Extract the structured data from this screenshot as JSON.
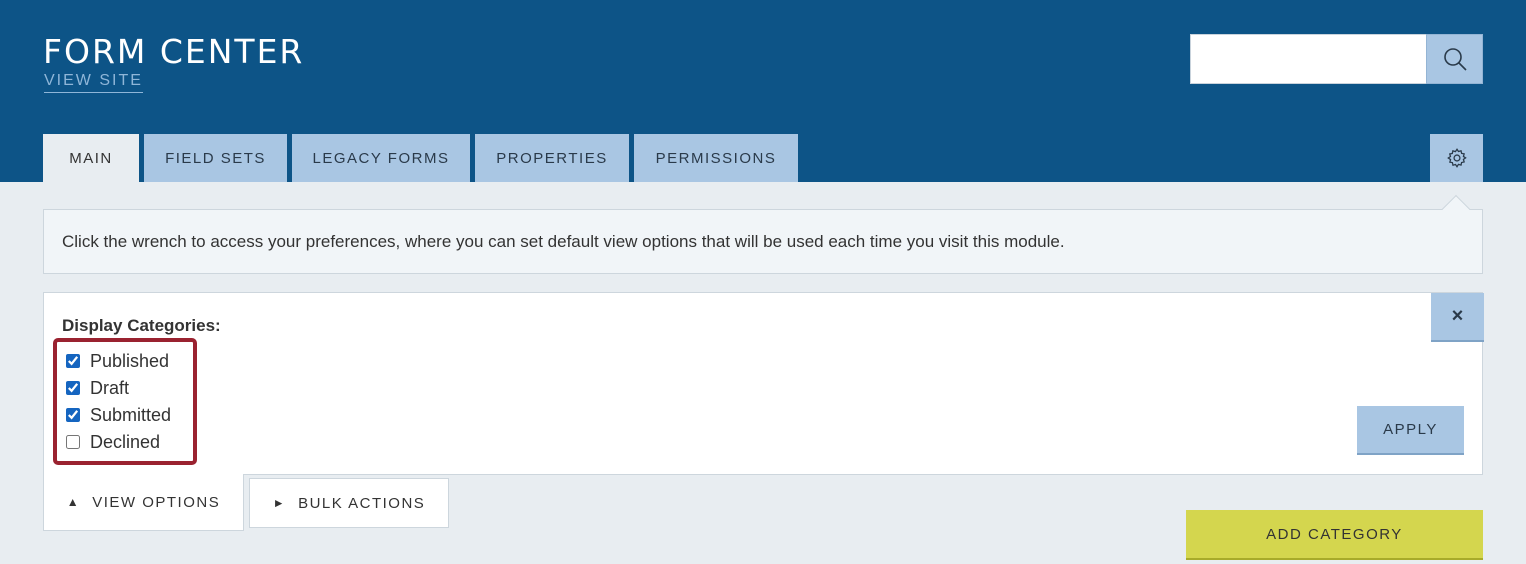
{
  "header": {
    "title": "FORM CENTER",
    "view_site": "VIEW SITE",
    "search": {
      "value": "",
      "placeholder": ""
    }
  },
  "tabs": [
    {
      "label": "MAIN",
      "active": true
    },
    {
      "label": "FIELD SETS",
      "active": false
    },
    {
      "label": "LEGACY FORMS",
      "active": false
    },
    {
      "label": "PROPERTIES",
      "active": false
    },
    {
      "label": "PERMISSIONS",
      "active": false
    }
  ],
  "info": {
    "message": "Click the wrench to access your preferences, where you can set default view options that will be used each time you visit this module."
  },
  "display_panel": {
    "label": "Display Categories:",
    "close": "×",
    "apply": "APPLY",
    "categories": [
      {
        "label": "Published",
        "checked": true
      },
      {
        "label": "Draft",
        "checked": true
      },
      {
        "label": "Submitted",
        "checked": true
      },
      {
        "label": "Declined",
        "checked": false
      }
    ]
  },
  "bottom": {
    "view_options": "VIEW OPTIONS",
    "view_options_arrow": "▲",
    "bulk_actions": "BULK ACTIONS",
    "bulk_actions_arrow": "►",
    "add_category": "ADD CATEGORY"
  },
  "colors": {
    "header_bg": "#0d5487",
    "tab_bg": "#a9c6e3",
    "page_bg": "#e8edf1",
    "highlight": "#9a2230",
    "add_button": "#d4d64e"
  },
  "icons": {
    "search": "search-icon",
    "settings": "gear-icon",
    "close": "close-icon"
  }
}
